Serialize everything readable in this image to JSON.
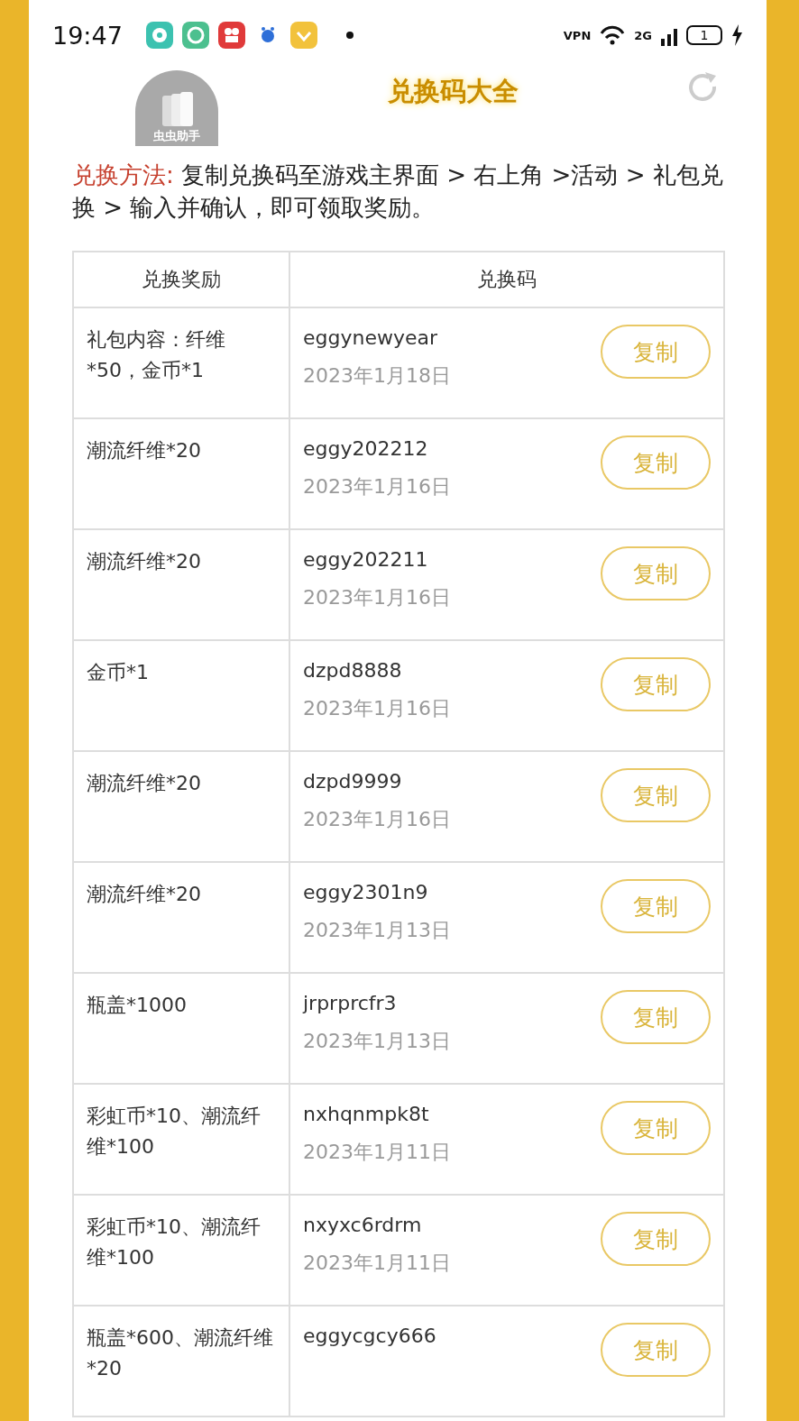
{
  "status_bar": {
    "time": "19:47",
    "battery": "1",
    "network": "2G",
    "vpn": "VPN"
  },
  "header": {
    "title": "兑换码大全",
    "logo_label": "虫虫助手"
  },
  "instructions": {
    "label": "兑换方法:",
    "text": "复制兑换码至游戏主界面 > 右上角 >活动 > 礼包兑换 > 输入并确认，即可领取奖励。"
  },
  "table": {
    "columns": [
      "兑换奖励",
      "兑换码"
    ],
    "rows": [
      {
        "reward": "礼包内容：纤维*50，金币*1",
        "code": "eggynewyear",
        "date": "2023年1月18日",
        "button": "复制"
      },
      {
        "reward": "潮流纤维*20",
        "code": "eggy202212",
        "date": "2023年1月16日",
        "button": "复制"
      },
      {
        "reward": "潮流纤维*20",
        "code": "eggy202211",
        "date": "2023年1月16日",
        "button": "复制"
      },
      {
        "reward": "金币*1",
        "code": "dzpd8888",
        "date": "2023年1月16日",
        "button": "复制"
      },
      {
        "reward": "潮流纤维*20",
        "code": "dzpd9999",
        "date": "2023年1月16日",
        "button": "复制"
      },
      {
        "reward": "潮流纤维*20",
        "code": "eggy2301n9",
        "date": "2023年1月13日",
        "button": "复制"
      },
      {
        "reward": "瓶盖*1000",
        "code": "jrprprcfr3",
        "date": "2023年1月13日",
        "button": "复制"
      },
      {
        "reward": "彩虹币*10、潮流纤维*100",
        "code": "nxhqnmpk8t",
        "date": "2023年1月11日",
        "button": "复制"
      },
      {
        "reward": "彩虹币*10、潮流纤维*100",
        "code": "nxyxc6rdrm",
        "date": "2023年1月11日",
        "button": "复制"
      },
      {
        "reward": "瓶盖*600、潮流纤维*20",
        "code": "eggycgcy666",
        "button": "复制"
      }
    ]
  }
}
